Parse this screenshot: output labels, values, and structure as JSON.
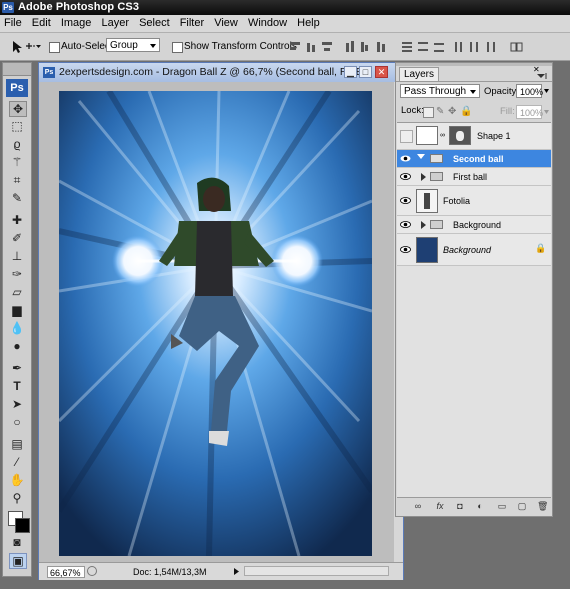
{
  "app": {
    "title": "Adobe Photoshop CS3",
    "badge": "Ps"
  },
  "menu": [
    "File",
    "Edit",
    "Image",
    "Layer",
    "Select",
    "Filter",
    "View",
    "Window",
    "Help"
  ],
  "options": {
    "auto_select_label": "Auto-Select:",
    "auto_select_value": "Group",
    "show_transform_label": "Show Transform Controls"
  },
  "toolbox": {
    "badge": "Ps"
  },
  "document": {
    "title": "2expertsdesign.com - Dragon Ball Z @ 66,7% (Second ball, RGB...",
    "zoom": "66,67%",
    "doc_info": "Doc: 1,54M/13,3M"
  },
  "layers_panel": {
    "tab": "Layers",
    "blend_mode": "Pass Through",
    "opacity_label": "Opacity:",
    "opacity_value": "100%",
    "lock_label": "Lock:",
    "fill_label": "Fill:",
    "fill_value": "100%",
    "layers": [
      {
        "name": "Shape 1",
        "visible": false,
        "type": "shape"
      },
      {
        "name": "Second ball",
        "visible": true,
        "type": "group",
        "selected": true
      },
      {
        "name": "First ball",
        "visible": true,
        "type": "group"
      },
      {
        "name": "Fotolia",
        "visible": true,
        "type": "image"
      },
      {
        "name": "Background",
        "visible": true,
        "type": "group"
      },
      {
        "name": "Background",
        "visible": true,
        "type": "background",
        "locked": true
      }
    ]
  },
  "colors": {
    "accent": "#3d86e0",
    "background_layer_fill": "#1e3f73"
  }
}
